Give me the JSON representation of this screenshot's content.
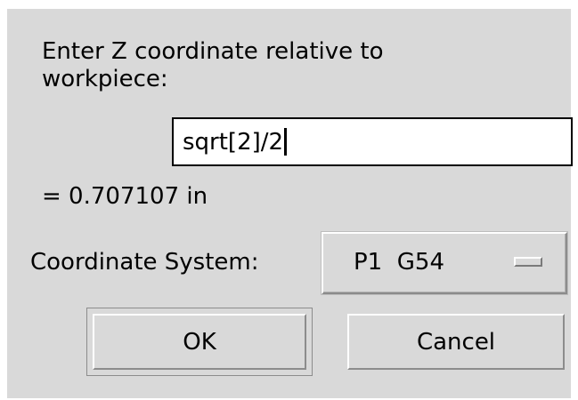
{
  "dialog": {
    "prompt": "Enter Z coordinate relative to\nworkpiece:",
    "entry_value": "sqrt[2]/2",
    "result": "= 0.707107 in",
    "coordinate_system_label": "Coordinate System:",
    "coordinate_system_value": "P1  G54",
    "ok_label": "OK",
    "cancel_label": "Cancel"
  },
  "colors": {
    "background": "#d9d9d9",
    "entry_background": "#ffffff",
    "text": "#000000"
  },
  "icons": {
    "option_menu_indicator": "option-menu-indicator-icon"
  }
}
